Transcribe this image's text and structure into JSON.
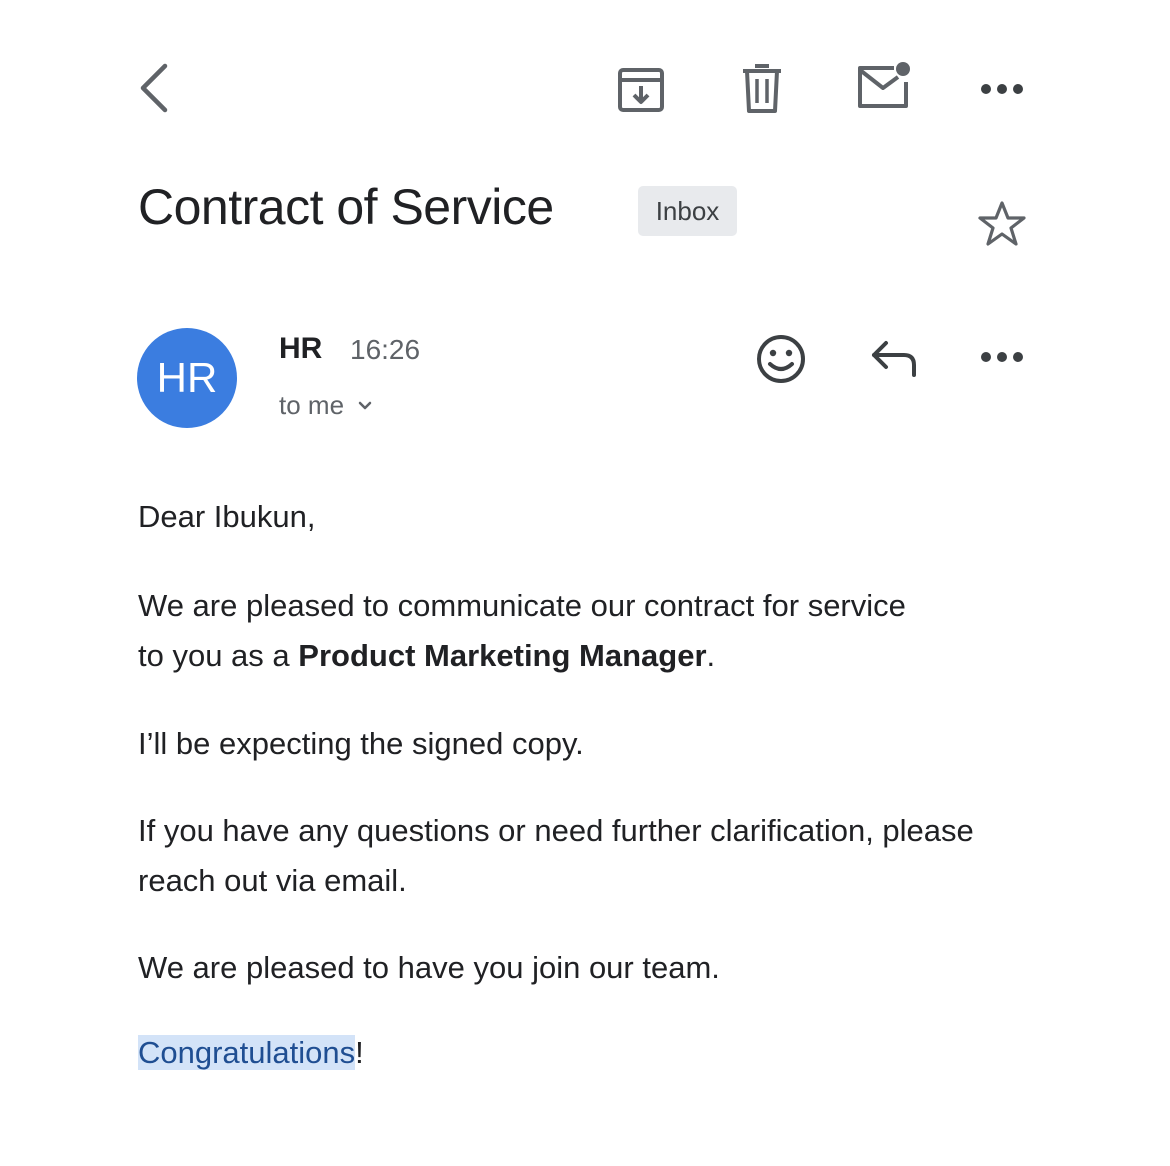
{
  "toolbar": {
    "back_icon": "chevron-left-icon",
    "archive_icon": "archive-icon",
    "delete_icon": "trash-icon",
    "mark_unread_icon": "mark-unread-icon",
    "more_icon": "more-horizontal-icon"
  },
  "email": {
    "subject": "Contract of Service",
    "label": "Inbox",
    "star_icon": "star-outline-icon",
    "sender": {
      "avatar_initials": "HR",
      "avatar_color": "#3b7de0",
      "name": "HR",
      "time": "16:26",
      "recipient": "to me"
    },
    "actions": {
      "emoji_icon": "emoji-reaction-icon",
      "reply_icon": "reply-icon",
      "more_icon": "more-horizontal-icon"
    },
    "body": {
      "greeting": "Dear Ibukun,",
      "p1_before": "We are pleased to communicate our contract for service to you as a ",
      "p1_bold": "Product Marketing Manager",
      "p1_after": ".",
      "p2": "I’ll be expecting the signed copy.",
      "p3": "If you have any questions or need further clarification, please reach out via email.",
      "p4": "We are pleased to have you join our team.",
      "closing_highlight": "Congratulations",
      "closing_end": "!"
    }
  },
  "colors": {
    "highlight_bg": "#d3e3f8",
    "highlight_text": "#1f4e92",
    "chip_bg": "#e8eaed"
  }
}
